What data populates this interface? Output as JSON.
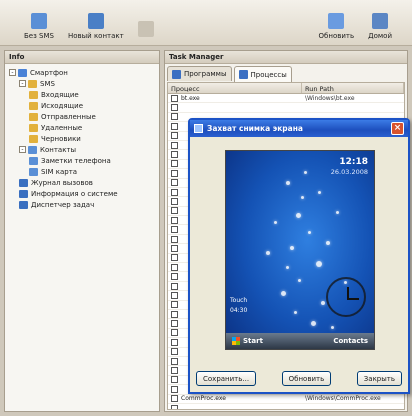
{
  "toolbar": {
    "buttons": [
      {
        "label": "Без SMS",
        "icon": "sms-icon",
        "color": "#5a8fd6"
      },
      {
        "label": "Новый контакт",
        "icon": "contact-icon",
        "color": "#4a7fc6"
      },
      {
        "label": "",
        "icon": "blank-icon",
        "color": "#c9c2b4"
      },
      {
        "label": "Обновить",
        "icon": "refresh-icon",
        "color": "#6a9be0"
      },
      {
        "label": "Домой",
        "icon": "home-icon",
        "color": "#5b86c4"
      }
    ]
  },
  "left_panel": {
    "title": "Info",
    "tree": [
      {
        "label": "Смартфон",
        "level": 0,
        "toggle": "-",
        "color": "#4a82d6"
      },
      {
        "label": "SMS",
        "level": 1,
        "toggle": "-",
        "color": "#e2b13c"
      },
      {
        "label": "Входящие",
        "level": 2,
        "toggle": "",
        "color": "#e2b13c"
      },
      {
        "label": "Исходящие",
        "level": 2,
        "toggle": "",
        "color": "#e2b13c"
      },
      {
        "label": "Отправленные",
        "level": 2,
        "toggle": "",
        "color": "#e2b13c"
      },
      {
        "label": "Удаленные",
        "level": 2,
        "toggle": "",
        "color": "#e2b13c"
      },
      {
        "label": "Черновики",
        "level": 2,
        "toggle": "",
        "color": "#e2b13c"
      },
      {
        "label": "Контакты",
        "level": 1,
        "toggle": "-",
        "color": "#5a8fd6"
      },
      {
        "label": "Заметки телефона",
        "level": 2,
        "toggle": "",
        "color": "#5a8fd6"
      },
      {
        "label": "SIM карта",
        "level": 2,
        "toggle": "",
        "color": "#5a8fd6"
      },
      {
        "label": "Журнал вызовов",
        "level": 1,
        "toggle": "",
        "color": "#3a6fc0"
      },
      {
        "label": "Информация о системе",
        "level": 1,
        "toggle": "",
        "color": "#3a6fc0"
      },
      {
        "label": "Диспетчер задач",
        "level": 1,
        "toggle": "",
        "color": "#3a6fc0"
      }
    ]
  },
  "right_panel": {
    "title": "Task Manager",
    "tabs": [
      {
        "label": "Программы",
        "active": false
      },
      {
        "label": "Процессы",
        "active": true
      }
    ],
    "columns": {
      "name": "Процесс",
      "path": "Run Path"
    },
    "rows": [
      {
        "name": "bt.exe",
        "path": "\\Windows\\bt.exe"
      },
      {
        "name": "",
        "path": ""
      },
      {
        "name": "",
        "path": ""
      },
      {
        "name": "",
        "path": ""
      },
      {
        "name": "",
        "path": ""
      },
      {
        "name": "",
        "path": ""
      },
      {
        "name": "",
        "path": ""
      },
      {
        "name": "",
        "path": ""
      },
      {
        "name": "",
        "path": ""
      },
      {
        "name": "",
        "path": ""
      },
      {
        "name": "",
        "path": ""
      },
      {
        "name": "",
        "path": ""
      },
      {
        "name": "",
        "path": ""
      },
      {
        "name": "",
        "path": ""
      },
      {
        "name": "",
        "path": ""
      },
      {
        "name": "",
        "path": ""
      },
      {
        "name": "",
        "path": ""
      },
      {
        "name": "",
        "path": ""
      },
      {
        "name": "",
        "path": ""
      },
      {
        "name": "",
        "path": ""
      },
      {
        "name": "",
        "path": ""
      },
      {
        "name": "",
        "path": ""
      },
      {
        "name": "",
        "path": ""
      },
      {
        "name": "",
        "path": ""
      },
      {
        "name": "",
        "path": ""
      },
      {
        "name": "",
        "path": ""
      },
      {
        "name": "",
        "path": ""
      },
      {
        "name": "",
        "path": ""
      },
      {
        "name": "",
        "path": ""
      },
      {
        "name": "",
        "path": ""
      },
      {
        "name": "",
        "path": ""
      },
      {
        "name": "",
        "path": ""
      },
      {
        "name": "CommProc.exe",
        "path": "\\Windows\\CommProc.exe"
      },
      {
        "name": "",
        "path": ""
      }
    ]
  },
  "dialog": {
    "title": "Захват снимка экрана",
    "phone_screen": {
      "time": "12:18",
      "date": "26.03.2008",
      "side_text_1": "Touch",
      "side_text_2": "04:30",
      "soft_left": "Start",
      "soft_right": "Contacts"
    },
    "buttons": {
      "save": "Сохранить...",
      "refresh": "Обновить",
      "close": "Закрыть"
    }
  }
}
